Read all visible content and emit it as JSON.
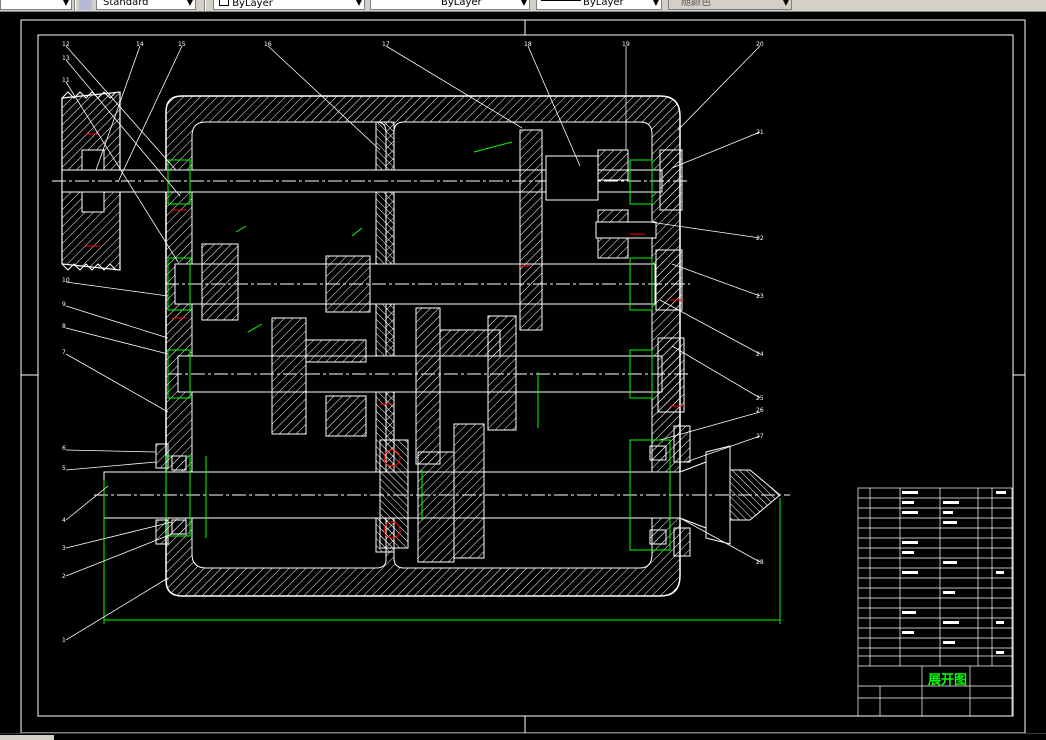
{
  "toolbar": {
    "text_style": "Standard",
    "color_control": "ByLayer",
    "linetype_control": "ByLayer",
    "lineweight_control": "ByLayer",
    "plotstyle_control": "随颜色"
  },
  "drawing": {
    "callouts": [
      "12",
      "14",
      "15",
      "16",
      "17",
      "18",
      "19",
      "13",
      "11",
      "10",
      "9",
      "8",
      "7",
      "6",
      "5",
      "4",
      "3",
      "2",
      "1",
      "20",
      "21",
      "22",
      "23",
      "24",
      "25",
      "26",
      "27",
      "28"
    ],
    "title_block": {
      "title": "展开图"
    }
  },
  "colors": {
    "outline": "#ffffff",
    "dimension": "#00ff00",
    "section_cut": "#ff0000",
    "title_text": "#00ff00"
  }
}
